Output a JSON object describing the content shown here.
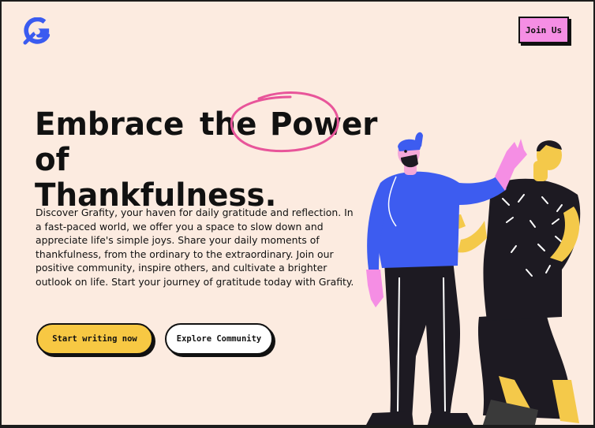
{
  "header": {
    "logo_icon": "grafity-logo-icon",
    "join_label": "Join Us"
  },
  "hero": {
    "headline": {
      "word1": "Embrace",
      "word2": "the",
      "word3": "Power",
      "word4": "of",
      "word5": "Thankfulness."
    },
    "description": "Discover Grafity, your haven for daily gratitude and reflection. In a fast-paced world, we offer you a space to slow down and appreciate life's simple joys. Share your daily moments of thankfulness, from the ordinary to the extraordinary. Join our positive community, inspire others, and cultivate a brighter outlook on life. Start your journey of gratitude today with Grafity.",
    "primary_cta": "Start writing now",
    "secondary_cta": "Explore Community"
  },
  "colors": {
    "background": "#fcebe0",
    "join_button": "#f58ee4",
    "primary_button": "#f7c843",
    "accent_ring": "#e8559a",
    "logo": "#3a5bf0"
  }
}
